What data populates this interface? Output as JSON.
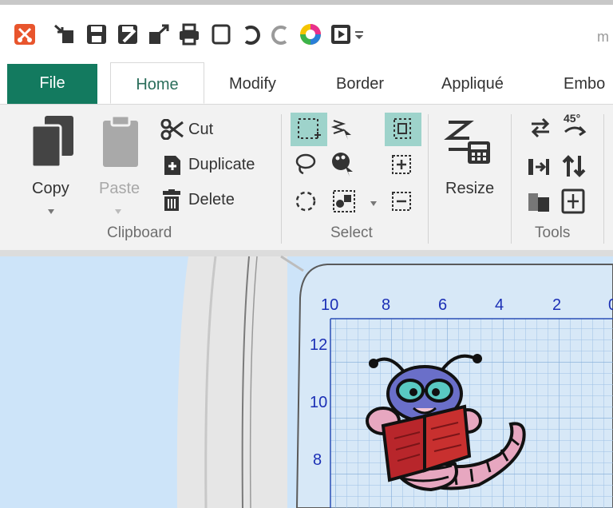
{
  "app": {
    "title_fragment": "m"
  },
  "quick_access": {
    "icons": [
      "app-logo-icon",
      "import-icon",
      "save-icon",
      "save-as-icon",
      "export-icon",
      "print-icon",
      "new-icon",
      "undo-icon",
      "redo-icon",
      "color-wheel-icon",
      "preview-icon",
      "customize-dropdown-icon"
    ]
  },
  "tabs": [
    {
      "label": "File"
    },
    {
      "label": "Home"
    },
    {
      "label": "Modify"
    },
    {
      "label": "Border"
    },
    {
      "label": "Appliqué"
    },
    {
      "label": "Embo"
    }
  ],
  "ribbon": {
    "clipboard": {
      "copy_label": "Copy",
      "paste_label": "Paste",
      "cut_label": "Cut",
      "duplicate_label": "Duplicate",
      "delete_label": "Delete",
      "group_label": "Clipboard"
    },
    "select": {
      "group_label": "Select"
    },
    "resize": {
      "label": "Resize"
    },
    "tools": {
      "group_label": "Tools"
    }
  },
  "ruler": {
    "top": [
      "10",
      "8",
      "6",
      "4",
      "2",
      "0"
    ],
    "left": [
      "12",
      "10",
      "8"
    ]
  },
  "colors": {
    "file_tab": "#137a5f",
    "ruler_text": "#1b2fb5",
    "canvas_bg": "#cde4f9",
    "grid_bg": "#d4e6f7"
  }
}
